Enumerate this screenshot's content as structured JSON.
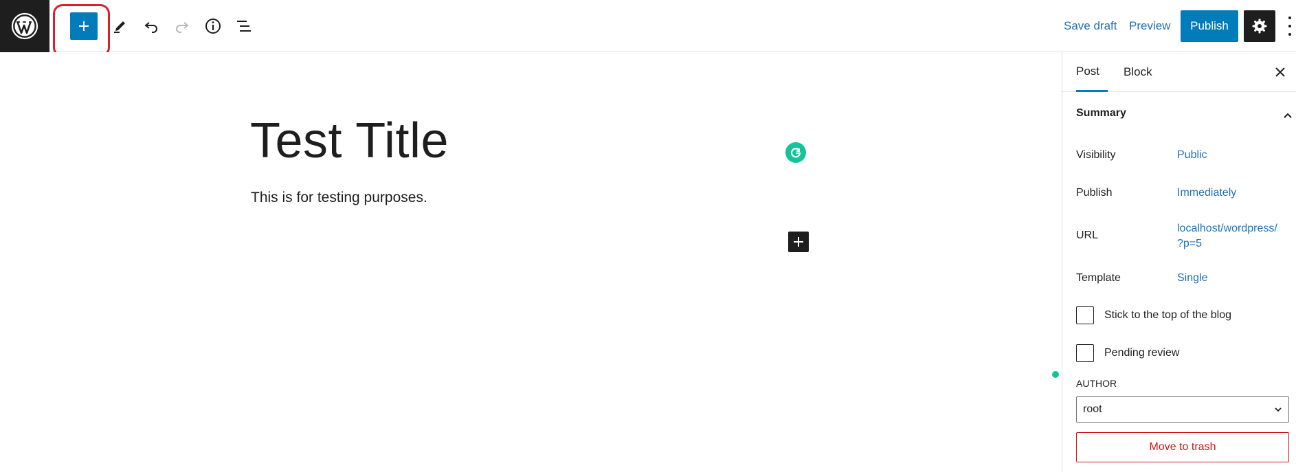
{
  "toolbar": {
    "save_draft": "Save draft",
    "preview": "Preview",
    "publish": "Publish"
  },
  "editor": {
    "title": "Test Title",
    "paragraph": "This is for testing purposes."
  },
  "sidebar": {
    "tabs": [
      {
        "label": "Post",
        "active": true
      },
      {
        "label": "Block",
        "active": false
      }
    ],
    "summary_heading": "Summary",
    "rows": [
      {
        "label": "Visibility",
        "value": "Public"
      },
      {
        "label": "Publish",
        "value": "Immediately"
      },
      {
        "label": "URL",
        "value_line1": "localhost/wordpress/",
        "value_line2": "?p=5"
      },
      {
        "label": "Template",
        "value": "Single"
      }
    ],
    "checkboxes": [
      {
        "label": "Stick to the top of the blog",
        "checked": false
      },
      {
        "label": "Pending review",
        "checked": false
      }
    ],
    "author_heading": "AUTHOR",
    "author_value": "root",
    "trash_label": "Move to trash"
  },
  "colors": {
    "accent": "#007cba",
    "link": "#2271b1",
    "danger": "#cc1818",
    "highlight": "#d9202a",
    "grammarly": "#15c39a"
  },
  "icons": {
    "logo": "wordpress-logo-icon",
    "inserter": "plus-icon",
    "tools": "pencil-icon",
    "undo": "undo-icon",
    "redo": "redo-icon",
    "details": "info-icon",
    "list_view": "list-view-icon",
    "settings": "gear-icon",
    "more": "more-vertical-icon"
  }
}
